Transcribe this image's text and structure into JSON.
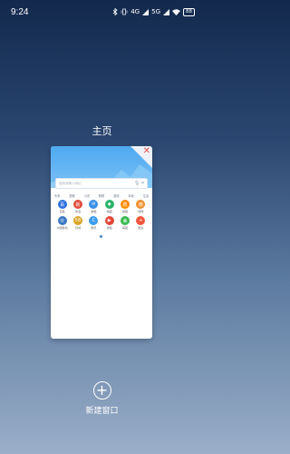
{
  "status": {
    "time": "9:24",
    "icons": [
      "bluetooth-icon",
      "vibrate-icon",
      "signal-icon",
      "wifi-icon",
      "battery-icon"
    ],
    "network_a": "4G",
    "network_b": "5G",
    "battery": "88"
  },
  "window": {
    "title": "主页"
  },
  "card": {
    "search_placeholder": "搜索或输入网址",
    "tabs": [
      "头条",
      "视频",
      "小说",
      "购物",
      "游戏",
      "本地",
      "生活"
    ],
    "apps": [
      {
        "label": "百度",
        "color": "#2f6fe0",
        "glyph": "百"
      },
      {
        "label": "新浪",
        "color": "#e24e3c",
        "glyph": "新"
      },
      {
        "label": "邮箱",
        "color": "#3a8fe6",
        "glyph": "✉"
      },
      {
        "label": "地图",
        "color": "#2bb36b",
        "glyph": "◆"
      },
      {
        "label": "携程",
        "color": "#ff8a00",
        "glyph": "携"
      },
      {
        "label": "微博",
        "color": "#f08f2e",
        "glyph": "微"
      },
      {
        "label": "中国移动",
        "color": "#3b78c6",
        "glyph": "◎"
      },
      {
        "label": "同城",
        "color": "#d9a428",
        "glyph": "58"
      },
      {
        "label": "腾讯",
        "color": "#3d9df0",
        "glyph": "C"
      },
      {
        "label": "视频",
        "color": "#e3483a",
        "glyph": "▶"
      },
      {
        "label": "美团",
        "color": "#35b84d",
        "glyph": "美"
      },
      {
        "label": "更多",
        "color": "#f0563c",
        "glyph": "+"
      }
    ],
    "close_icon": "close-icon"
  },
  "new_window": {
    "label": "新建窗口"
  }
}
